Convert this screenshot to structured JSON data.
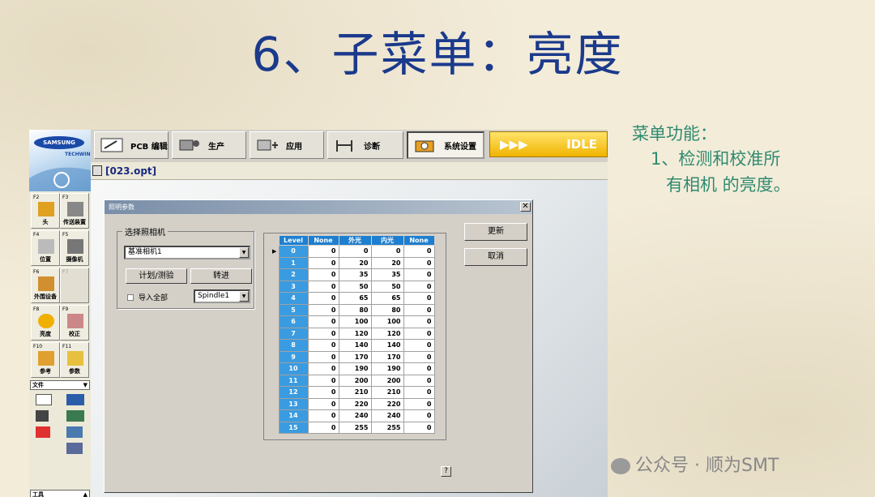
{
  "slide": {
    "title": "6、子菜单：亮度",
    "note_heading": "菜单功能：",
    "note_line1": "1、检测和校准所",
    "note_line2": "有相机 的亮度。",
    "watermark": "公众号 · 顺为SMT"
  },
  "app": {
    "logo_text": "SAMSUNG",
    "logo_sub": "TECHWIN",
    "toolbar": [
      {
        "label": "PCB 编辑",
        "icon": "pcb-edit-icon"
      },
      {
        "label": "生产",
        "icon": "production-icon"
      },
      {
        "label": "应用",
        "icon": "apply-icon"
      },
      {
        "label": "诊断",
        "icon": "diagnose-icon"
      },
      {
        "label": "系统设置",
        "icon": "system-settings-icon"
      }
    ],
    "status": "IDLE",
    "status_arrows": "▶▶▶",
    "file": "[023.opt]",
    "fkeys": [
      {
        "key": "F2",
        "label": "头"
      },
      {
        "key": "F3",
        "label": "传送装置"
      },
      {
        "key": "F4",
        "label": "位置"
      },
      {
        "key": "F5",
        "label": "摄像机"
      },
      {
        "key": "F6",
        "label": "外围设备"
      },
      {
        "key": "F7",
        "label": ""
      },
      {
        "key": "F8",
        "label": "亮度"
      },
      {
        "key": "F9",
        "label": "校正"
      },
      {
        "key": "F10",
        "label": "参考"
      },
      {
        "key": "F11",
        "label": "参数"
      }
    ],
    "file_section": "文件",
    "tool_section": "工具"
  },
  "dialog": {
    "title": "照明参数",
    "close": "✕",
    "group_label": "选择照相机",
    "camera_value": "基准相机1",
    "plan_button": "计划/测验",
    "transfer_button": "转进",
    "import_all_label": "导入全部",
    "spindle_value": "Spindle1",
    "update_button": "更新",
    "cancel_button": "取消",
    "help": "?",
    "table": {
      "headers": [
        "Level",
        "None",
        "外光",
        "内光",
        "None"
      ],
      "rows": [
        [
          "0",
          "0",
          "0",
          "0",
          "0"
        ],
        [
          "1",
          "0",
          "20",
          "20",
          "0"
        ],
        [
          "2",
          "0",
          "35",
          "35",
          "0"
        ],
        [
          "3",
          "0",
          "50",
          "50",
          "0"
        ],
        [
          "4",
          "0",
          "65",
          "65",
          "0"
        ],
        [
          "5",
          "0",
          "80",
          "80",
          "0"
        ],
        [
          "6",
          "0",
          "100",
          "100",
          "0"
        ],
        [
          "7",
          "0",
          "120",
          "120",
          "0"
        ],
        [
          "8",
          "0",
          "140",
          "140",
          "0"
        ],
        [
          "9",
          "0",
          "170",
          "170",
          "0"
        ],
        [
          "10",
          "0",
          "190",
          "190",
          "0"
        ],
        [
          "11",
          "0",
          "200",
          "200",
          "0"
        ],
        [
          "12",
          "0",
          "210",
          "210",
          "0"
        ],
        [
          "13",
          "0",
          "220",
          "220",
          "0"
        ],
        [
          "14",
          "0",
          "240",
          "240",
          "0"
        ],
        [
          "15",
          "0",
          "255",
          "255",
          "0"
        ]
      ]
    }
  }
}
